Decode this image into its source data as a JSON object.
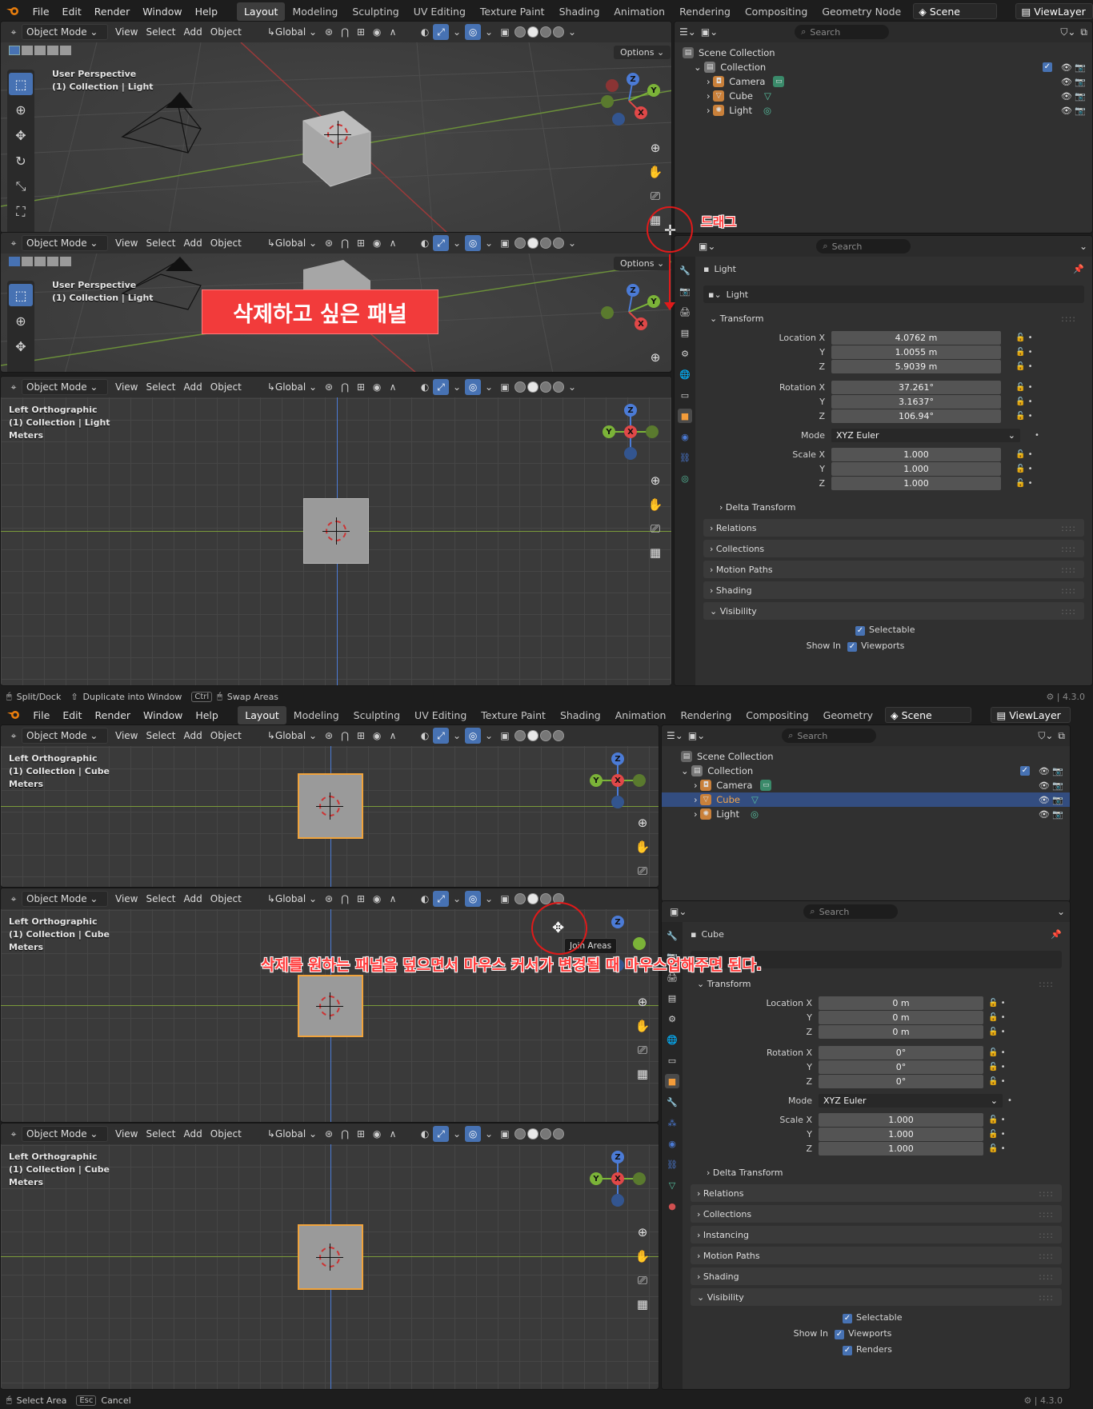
{
  "menu": [
    "File",
    "Edit",
    "Render",
    "Window",
    "Help"
  ],
  "workspaces": [
    "Layout",
    "Modeling",
    "Sculpting",
    "UV Editing",
    "Texture Paint",
    "Shading",
    "Animation",
    "Rendering",
    "Compositing",
    "Geometry Node"
  ],
  "workspaces2": [
    "Layout",
    "Modeling",
    "Sculpting",
    "UV Editing",
    "Texture Paint",
    "Shading",
    "Animation",
    "Rendering",
    "Compositing",
    "Geometry"
  ],
  "scene": "Scene",
  "view_layer": "ViewLayer",
  "vp_header": {
    "mode": "Object Mode",
    "view": "View",
    "select": "Select",
    "add": "Add",
    "object": "Object",
    "transform": "Global",
    "options": "Options"
  },
  "vp_top": {
    "line1": "User Perspective",
    "line2": "(1) Collection | Light"
  },
  "vp_left_light": {
    "line1": "Left Orthographic",
    "line2": "(1) Collection | Light",
    "line3": "Meters"
  },
  "vp_left_cube": {
    "line1": "Left Orthographic",
    "line2": "(1) Collection | Cube",
    "line3": "Meters"
  },
  "outliner": {
    "search": "Search",
    "root": "Scene Collection",
    "collection": "Collection",
    "items": [
      "Camera",
      "Cube",
      "Light"
    ]
  },
  "props_top": {
    "search": "Search",
    "object": "Light",
    "data_name": "Light",
    "transform": "Transform",
    "loc_label": "Location X",
    "loc": [
      "4.0762 m",
      "1.0055 m",
      "5.9039 m"
    ],
    "rot_label": "Rotation X",
    "rot": [
      "37.261°",
      "3.1637°",
      "106.94°"
    ],
    "mode_label": "Mode",
    "mode": "XYZ Euler",
    "scale_label": "Scale X",
    "scale": [
      "1.000",
      "1.000",
      "1.000"
    ],
    "y": "Y",
    "z": "Z",
    "delta": "Delta Transform",
    "sections": [
      "Relations",
      "Collections",
      "Motion Paths",
      "Shading",
      "Visibility"
    ],
    "selectable": "Selectable",
    "show_in": "Show In",
    "viewports": "Viewports"
  },
  "props_bottom": {
    "search": "Search",
    "object": "Cube",
    "transform": "Transform",
    "loc_label": "Location X",
    "loc": [
      "0 m",
      "0 m",
      "0 m"
    ],
    "rot_label": "Rotation X",
    "rot": [
      "0°",
      "0°",
      "0°"
    ],
    "mode_label": "Mode",
    "mode": "XYZ Euler",
    "scale_label": "Scale X",
    "scale": [
      "1.000",
      "1.000",
      "1.000"
    ],
    "y": "Y",
    "z": "Z",
    "delta": "Delta Transform",
    "sections": [
      "Relations",
      "Collections",
      "Instancing",
      "Motion Paths",
      "Shading",
      "Visibility"
    ],
    "selectable": "Selectable",
    "show_in": "Show In",
    "viewports": "Viewports",
    "renders": "Renders"
  },
  "status_top": {
    "split": "Split/Dock",
    "duplicate": "Duplicate into Window",
    "ctrl": "Ctrl",
    "swap": "Swap Areas",
    "version": "4.3.0"
  },
  "status_bottom": {
    "select": "Select Area",
    "esc": "Esc",
    "cancel": "Cancel",
    "version": "4.3.0"
  },
  "annotations": {
    "drag": "드래그",
    "delete_panel": "삭제하고 싶은 패널",
    "instruction": "삭제를 원하는 패널을 덮으면서 마우스 커서가 변경될 때 마우스업해주면 된다.",
    "tooltip": "Join Areas"
  },
  "colors": {
    "accent": "#4772b3",
    "annotation": "#f23b3b",
    "selection": "#f0a33c"
  }
}
